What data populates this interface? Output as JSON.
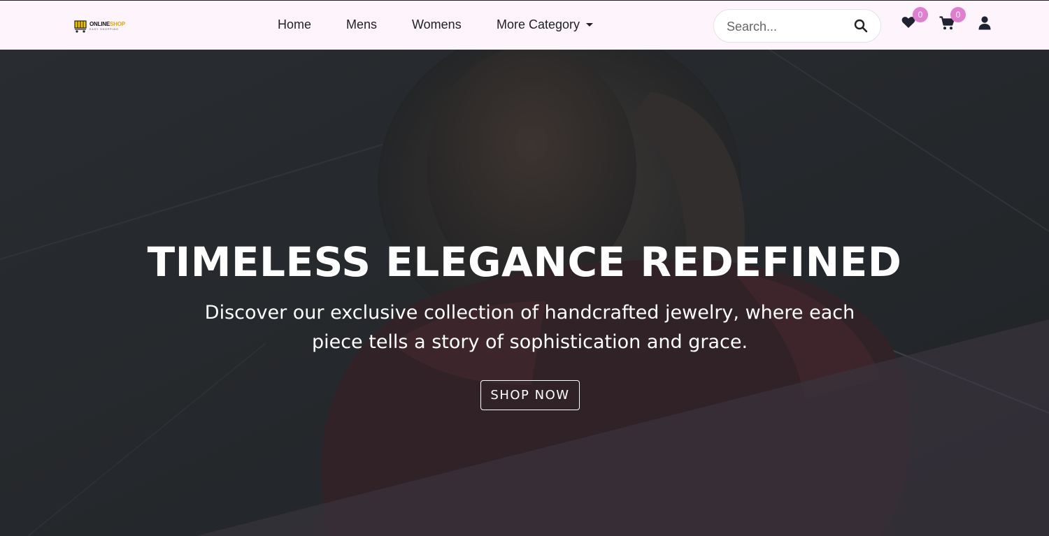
{
  "brand": {
    "name_primary": "ONLINE",
    "name_accent": "SHOP",
    "tagline": "EASY SHOPPING"
  },
  "nav": {
    "items": [
      {
        "label": "Home"
      },
      {
        "label": "Mens"
      },
      {
        "label": "Womens"
      },
      {
        "label": "More Category"
      }
    ]
  },
  "search": {
    "placeholder": "Search...",
    "icon": "search-icon"
  },
  "actions": {
    "wishlist": {
      "icon": "heart-icon",
      "count": "0"
    },
    "cart": {
      "icon": "cart-icon",
      "count": "0"
    },
    "account": {
      "icon": "user-icon"
    }
  },
  "hero": {
    "title": "TIMELESS ELEGANCE REDEFINED",
    "subtitle": "Discover our exclusive collection of handcrafted jewelry, where each piece tells a story of sophistication and grace.",
    "cta_label": "SHOP NOW"
  },
  "colors": {
    "navbar_bg": "#fdf5fb",
    "badge": "#e07fd0",
    "overlay": "#1e2022",
    "diagonal": "#3a2f3c",
    "logo_accent": "#e0a800"
  }
}
